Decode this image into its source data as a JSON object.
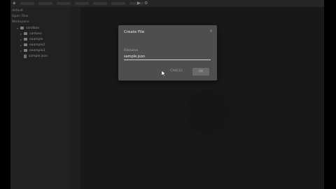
{
  "sidebar": {
    "header": "default",
    "open_files_label": "Open Files",
    "workspace_label": "Workspace",
    "tree": [
      {
        "label": "sandbox",
        "type": "folder",
        "indent": 0
      },
      {
        "label": "contoso",
        "type": "folder",
        "indent": 1
      },
      {
        "label": "example",
        "type": "folder",
        "indent": 1
      },
      {
        "label": "example2",
        "type": "folder",
        "indent": 1
      },
      {
        "label": "example3",
        "type": "folder",
        "indent": 1
      },
      {
        "label": "sample.json",
        "type": "file",
        "indent": 1
      }
    ]
  },
  "dialog": {
    "title": "Create File",
    "close_icon": "close-icon",
    "field_label": "Filename",
    "filename_value": "sample.json",
    "cancel_label": "CANCEL",
    "ok_label": "OK"
  },
  "colors": {
    "background": "#1e1e1e",
    "dialog": "#4e4e4e",
    "sidebar": "#252525",
    "input_underline": "#d0d0d0"
  }
}
